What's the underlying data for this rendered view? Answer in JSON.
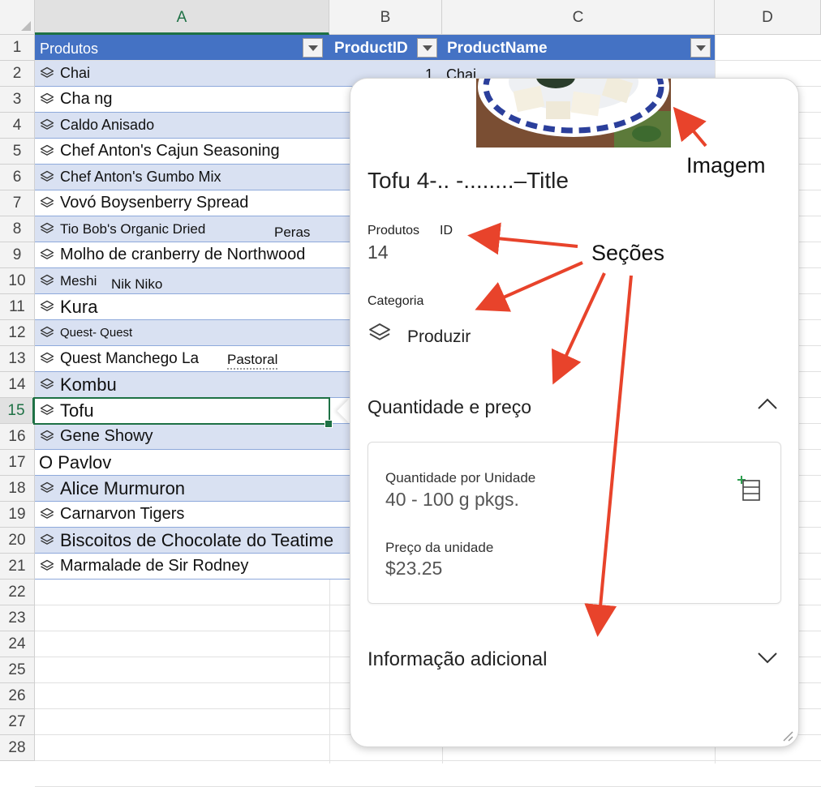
{
  "columns": [
    "A",
    "B",
    "C",
    "D"
  ],
  "rows": [
    "1",
    "2",
    "3",
    "4",
    "5",
    "6",
    "7",
    "8",
    "9",
    "10",
    "11",
    "12",
    "13",
    "14",
    "15",
    "16",
    "17",
    "18",
    "19",
    "20",
    "21",
    "22",
    "23",
    "24",
    "25",
    "26",
    "27",
    "28"
  ],
  "table_header": {
    "col_a": "Produtos",
    "col_b": "ProductID",
    "col_c": "ProductName"
  },
  "row2_extra": {
    "b": "1",
    "c": "Chai"
  },
  "products": [
    "Chai",
    "Cha ng",
    "Caldo Anisado",
    "Chef Anton's Cajun Seasoning",
    "Chef Anton's Gumbo Mix",
    "Vovó Boysenberry Spread",
    "Tio Bob's Organic Dried",
    "Molho de cranberry de Northwood",
    "Meshi",
    "Kura",
    "Quest- Quest",
    "Quest Manchego La",
    "Kombu",
    "Tofu",
    "Gene Showy",
    "O Pavlov",
    "Alice Murmuron",
    "Carnarvon Tigers",
    "Biscoitos de Chocolate do Teatime",
    "Marmalade de Sir Rodney"
  ],
  "product_suffixes": {
    "row8": "Peras",
    "row10": "Nik Niko",
    "row13": "Pastoral"
  },
  "card": {
    "title": "Tofu 4-.. -........–Title",
    "id_label_a": "Produtos",
    "id_label_b": "ID",
    "id_value": "14",
    "category_label": "Categoria",
    "category_value": "Produzir",
    "section1_title": "Quantidade e preço",
    "qty_label": "Quantidade por Unidade",
    "qty_value": "40 - 100 g pkgs.",
    "price_label": "Preço da unidade",
    "price_value": "$23.25",
    "section2_title": "Informação adicional"
  },
  "annotations": {
    "image": "Imagem",
    "sections": "Seções"
  },
  "colors": {
    "header_blue": "#4472c4",
    "band_blue": "#d9e1f2",
    "excel_green": "#1e7145",
    "arrow_red": "#e8432b"
  },
  "icons": [
    "entity-icon",
    "chevron-up-icon",
    "chevron-down-icon",
    "add-to-grid-icon",
    "filter-dropdown-icon"
  ]
}
